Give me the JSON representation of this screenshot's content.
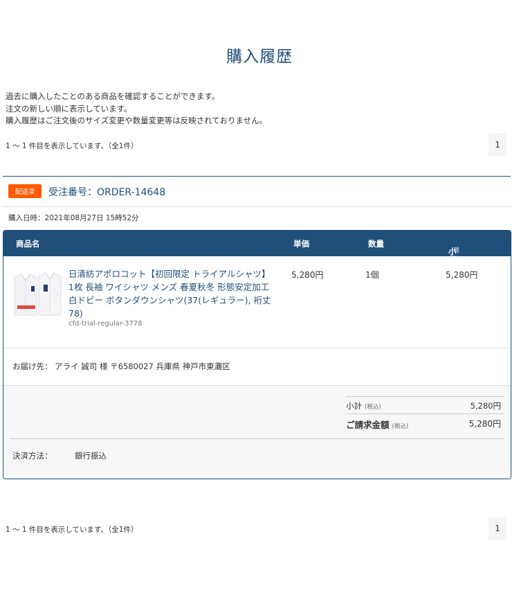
{
  "page": {
    "title": "購入履歴",
    "intro_lines": [
      "過去に購入したことのある商品を確認することができます。",
      "注文の新しい順に表示しています。",
      "購入履歴はご注文後のサイズ変更や数量変更等は反映されておりません。"
    ]
  },
  "pagination": {
    "count_text": "1 ～ 1 件目を表示しています。（全1件）",
    "pages": [
      "1"
    ]
  },
  "order": {
    "status": "配送済",
    "status_color": "#ff5a00",
    "order_number": "受注番号：ORDER-14648",
    "purchase_date": "購入日時：2021年08月27日 15時52分",
    "columns": {
      "name": "商品名",
      "price": "単価",
      "qty": "数量",
      "subtotal": "小計",
      "tax_note": "(税込)"
    },
    "items": [
      {
        "title": "日清紡アポロコット【初回限定 トライアルシャツ】1枚 長袖 ワイシャツ メンズ 春夏秋冬 形態安定加工 白ドビー ボタンダウンシャツ(37(レギュラー), 裄丈78)",
        "code": "cfd-trial-regular-3778",
        "price": "5,280円",
        "qty": "1個",
        "subtotal": "5,280円",
        "thumbnail_icon": "dress-shirt-icon"
      }
    ],
    "delivery": "お届け先： アライ 誠司 様 〒6580027 兵庫県 神戸市東灘区",
    "totals": {
      "subtotal_label": "小計",
      "subtotal_value": "5,280円",
      "grand_label": "ご請求金額",
      "grand_value": "5,280円",
      "tax_note": "(税込)"
    },
    "payment": {
      "label": "決済方法：",
      "value": "銀行振込"
    }
  },
  "colors": {
    "brand": "#1f4e79",
    "badge": "#ff5a00"
  }
}
